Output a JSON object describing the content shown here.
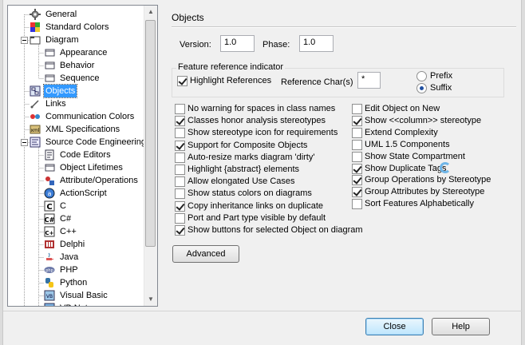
{
  "tree": {
    "items": [
      {
        "label": "General",
        "icon": "gear-icon"
      },
      {
        "label": "Standard Colors",
        "icon": "palette-icon"
      },
      {
        "label": "Diagram",
        "icon": "folder-icon"
      },
      {
        "label": "Appearance",
        "icon": "page-icon"
      },
      {
        "label": "Behavior",
        "icon": "page-icon"
      },
      {
        "label": "Sequence",
        "icon": "page-icon"
      },
      {
        "label": "Objects",
        "icon": "objects-icon"
      },
      {
        "label": "Links",
        "icon": "link-icon"
      },
      {
        "label": "Communication Colors",
        "icon": "communication-icon"
      },
      {
        "label": "XML Specifications",
        "icon": "xml-icon"
      },
      {
        "label": "Source Code Engineering",
        "icon": "code-engineering-icon"
      },
      {
        "label": "Code Editors",
        "icon": "code-editor-icon"
      },
      {
        "label": "Object Lifetimes",
        "icon": "page-icon"
      },
      {
        "label": "Attribute/Operations",
        "icon": "attribute-icon"
      },
      {
        "label": "ActionScript",
        "icon": "actionscript-icon"
      },
      {
        "label": "C",
        "icon": "c-language-icon"
      },
      {
        "label": "C#",
        "icon": "csharp-language-icon"
      },
      {
        "label": "C++",
        "icon": "cpp-language-icon"
      },
      {
        "label": "Delphi",
        "icon": "delphi-icon"
      },
      {
        "label": "Java",
        "icon": "java-icon"
      },
      {
        "label": "PHP",
        "icon": "php-icon"
      },
      {
        "label": "Python",
        "icon": "python-icon"
      },
      {
        "label": "Visual Basic",
        "icon": "visual-basic-icon"
      },
      {
        "label": "VB.Net",
        "icon": "vbnet-icon"
      }
    ],
    "selected": "Objects"
  },
  "panel": {
    "title": "Objects",
    "version_label": "Version:",
    "version_value": "1.0",
    "phase_label": "Phase:",
    "phase_value": "1.0"
  },
  "feature": {
    "title": "Feature reference indicator",
    "highlight_label": "Highlight References",
    "highlight_checked": true,
    "refchar_label": "Reference Char(s)",
    "refchar_value": "*",
    "prefix_label": "Prefix",
    "suffix_label": "Suffix",
    "selected_position": "Suffix"
  },
  "options_left": [
    {
      "label": "No warning for spaces in class names",
      "checked": false
    },
    {
      "label": "Classes honor analysis stereotypes",
      "checked": true
    },
    {
      "label": "Show stereotype icon for requirements",
      "checked": false
    },
    {
      "label": "Support for Composite Objects",
      "checked": true
    },
    {
      "label": "Auto-resize marks diagram 'dirty'",
      "checked": false
    },
    {
      "label": "Highlight {abstract} elements",
      "checked": false
    },
    {
      "label": "Allow elongated Use Cases",
      "checked": false
    },
    {
      "label": "Show status colors on diagrams",
      "checked": false
    },
    {
      "label": "Copy inheritance links on duplicate",
      "checked": true
    },
    {
      "label": "Port and Part type visible by default",
      "checked": false
    },
    {
      "label": "Show buttons for selected Object on diagram",
      "checked": true
    }
  ],
  "options_right": [
    {
      "label": "Edit Object on New",
      "checked": false
    },
    {
      "label": "Show <<column>> stereotype",
      "checked": true
    },
    {
      "label": "Extend Complexity",
      "checked": false
    },
    {
      "label": "UML 1.5 Components",
      "checked": false
    },
    {
      "label": "Show State Compartment",
      "checked": false
    },
    {
      "label": "Show Duplicate Tags",
      "checked": true
    },
    {
      "label": "Group Operations by Stereotype",
      "checked": true
    },
    {
      "label": "Group Attributes by Stereotype",
      "checked": true
    },
    {
      "label": "Sort Features Alphabetically",
      "checked": false
    }
  ],
  "buttons": {
    "advanced": "Advanced",
    "close": "Close",
    "help": "Help"
  }
}
